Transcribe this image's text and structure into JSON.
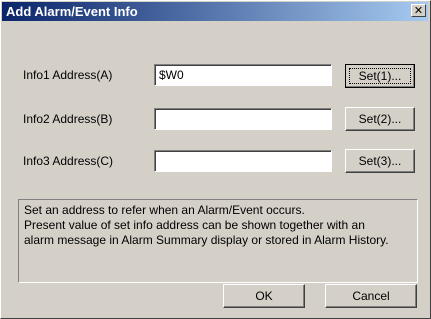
{
  "window": {
    "title": "Add Alarm/Event Info",
    "close_symbol": "✕"
  },
  "fields": [
    {
      "label": "Info1 Address(A)",
      "value": "$W0",
      "button": "Set(1)..."
    },
    {
      "label": "Info2 Address(B)",
      "value": "",
      "button": "Set(2)..."
    },
    {
      "label": "Info3 Address(C)",
      "value": "",
      "button": "Set(3)..."
    }
  ],
  "description": {
    "lines": [
      "Set an address to refer when an Alarm/Event occurs.",
      "Present value of set info address can be shown together with an",
      "alarm message in Alarm Summary display or stored in Alarm History."
    ]
  },
  "buttons": {
    "ok": "OK",
    "cancel": "Cancel"
  },
  "icons": {
    "close": "close-icon"
  }
}
